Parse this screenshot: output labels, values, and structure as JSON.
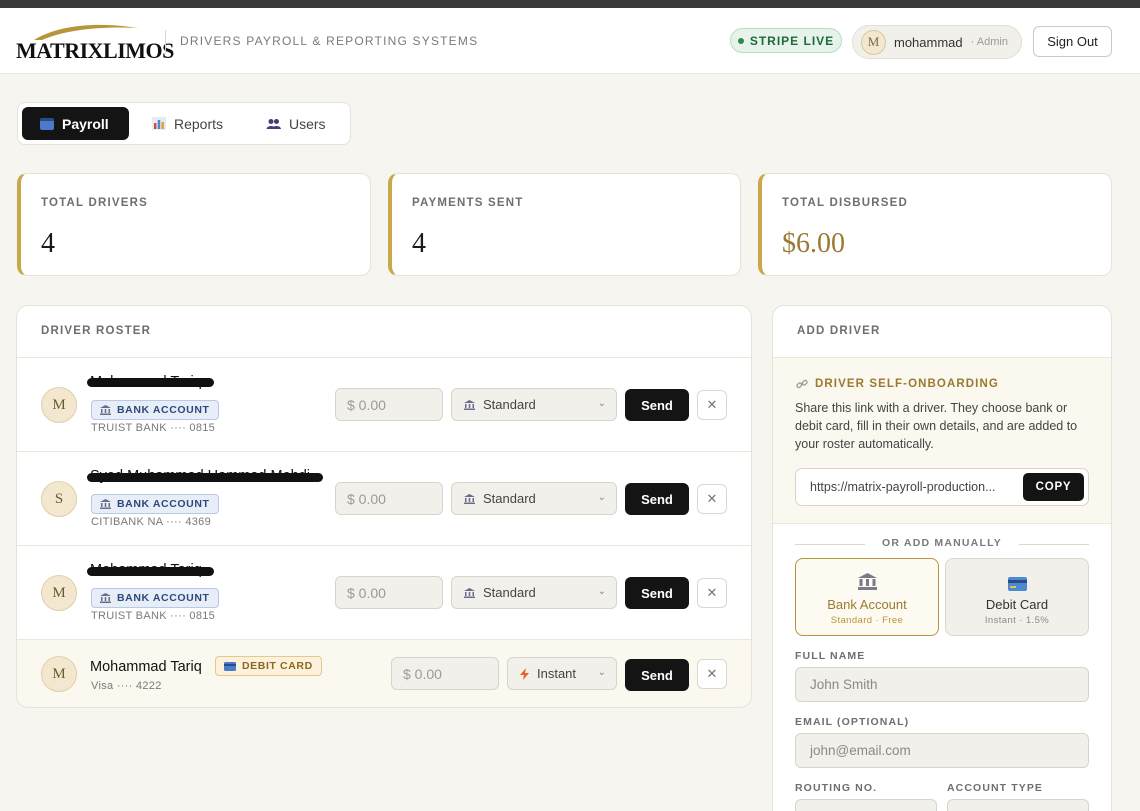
{
  "header": {
    "logo_text": "MATRIXLIMOS",
    "subtitle": "DRIVERS PAYROLL & REPORTING SYSTEMS",
    "stripe_badge": "STRIPE LIVE",
    "user": {
      "initial": "M",
      "name": "mohammad",
      "role": "· Admin"
    },
    "signout_label": "Sign Out"
  },
  "tabs": [
    {
      "label": "Payroll",
      "icon": "card-icon",
      "active": true
    },
    {
      "label": "Reports",
      "icon": "chart-icon",
      "active": false
    },
    {
      "label": "Users",
      "icon": "users-icon",
      "active": false
    }
  ],
  "stats": {
    "total_drivers": {
      "label": "TOTAL DRIVERS",
      "value": "4"
    },
    "payments_sent": {
      "label": "PAYMENTS SENT",
      "value": "4"
    },
    "total_disbursed": {
      "label": "TOTAL DISBURSED",
      "value": "$6.00"
    }
  },
  "roster": {
    "title": "DRIVER ROSTER",
    "rows": [
      {
        "initial": "M",
        "name": "Mohammad Tariq",
        "method": "BANK ACCOUNT",
        "account": "TRUIST BANK ···· 0815",
        "amount_placeholder": "$ 0.00",
        "speed": "Standard",
        "send": "Send",
        "remove": "✕"
      },
      {
        "initial": "S",
        "name": "Syed Muhammad Hammad Mehdi",
        "method": "BANK ACCOUNT",
        "account": "CITIBANK NA ···· 4369",
        "amount_placeholder": "$ 0.00",
        "speed": "Standard",
        "send": "Send",
        "remove": "✕"
      },
      {
        "initial": "M",
        "name": "Mohammad Tariq",
        "method": "BANK ACCOUNT",
        "account": "TRUIST BANK ···· 0815",
        "amount_placeholder": "$ 0.00",
        "speed": "Standard",
        "send": "Send",
        "remove": "✕"
      },
      {
        "initial": "M",
        "name": "Mohammad Tariq",
        "method": "DEBIT CARD",
        "account": "Visa ···· 4222",
        "amount_placeholder": "$ 0.00",
        "speed": "Instant",
        "send": "Send",
        "remove": "✕"
      }
    ]
  },
  "add_driver": {
    "title": "ADD DRIVER",
    "onboarding_title": "DRIVER SELF-ONBOARDING",
    "onboarding_desc": "Share this link with a driver. They choose bank or debit card, fill in their own details, and are added to your roster automatically.",
    "link": "https://matrix-payroll-production...",
    "copy_label": "COPY",
    "or_label": "OR ADD MANUALLY",
    "bank_option": {
      "title": "Bank Account",
      "sub": "Standard · Free"
    },
    "card_option": {
      "title": "Debit Card",
      "sub": "Instant · 1.5%"
    },
    "full_name": {
      "label": "FULL NAME",
      "placeholder": "John Smith"
    },
    "email": {
      "label": "EMAIL (OPTIONAL)",
      "placeholder": "john@email.com"
    },
    "routing_label": "ROUTING NO.",
    "account_type_label": "ACCOUNT TYPE"
  },
  "colors": {
    "accent_gold": "#c9a84c",
    "dark": "#141414",
    "stripe_green": "#1e6b3a"
  }
}
